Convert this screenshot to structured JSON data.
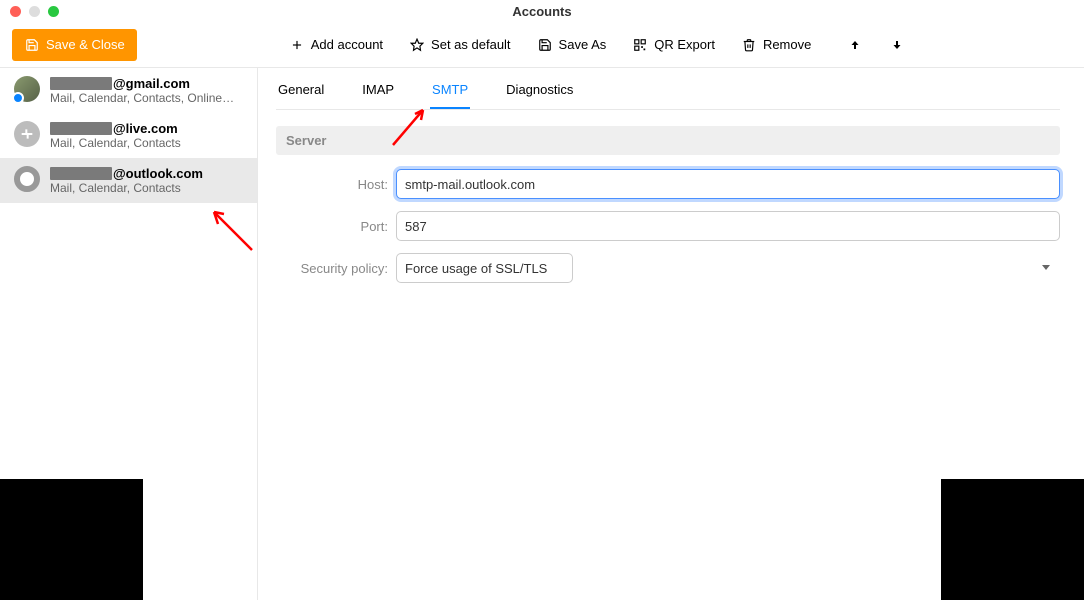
{
  "window": {
    "title": "Accounts"
  },
  "toolbar": {
    "save_close": "Save & Close",
    "add_account": "Add account",
    "set_default": "Set as default",
    "save_as": "Save As",
    "qr_export": "QR Export",
    "remove": "Remove"
  },
  "sidebar": {
    "accounts": [
      {
        "email_suffix": "@gmail.com",
        "sub": "Mail, Calendar, Contacts, Online…",
        "selected": false
      },
      {
        "email_suffix": "@live.com",
        "sub": "Mail, Calendar, Contacts",
        "selected": false
      },
      {
        "email_suffix": "@outlook.com",
        "sub": "Mail, Calendar, Contacts",
        "selected": true
      }
    ]
  },
  "tabs": {
    "items": [
      "General",
      "IMAP",
      "SMTP",
      "Diagnostics"
    ],
    "active": "SMTP"
  },
  "section": {
    "server": "Server"
  },
  "form": {
    "host_label": "Host:",
    "host_value": "smtp-mail.outlook.com",
    "port_label": "Port:",
    "port_value": "587",
    "security_label": "Security policy:",
    "security_value": "Force usage of SSL/TLS"
  }
}
